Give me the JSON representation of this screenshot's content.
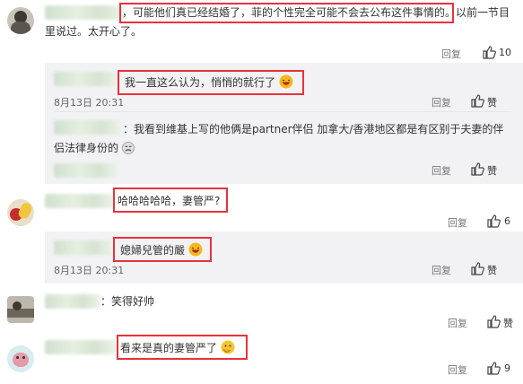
{
  "comments": [
    {
      "text_line1": "，可能他们真已经结婚了，菲的个性完全可能不会去公布这件事情的。以前一节目",
      "text_line2": "里说过。太开心了。",
      "reply_label": "回复",
      "like_count": "10",
      "sub_replies": [
        {
          "text": "我一直这么认为，悄悄的就行了",
          "date": "8月13日 20:31",
          "reply_label": "回复",
          "like_label": "赞"
        },
        {
          "text_line1": "：我看到维基上写的他俩是partner伴侣 加拿大/香港地区都是有区别于夫妻的伴",
          "text_line2": "侣法律身份的",
          "reply_label": "回复",
          "like_label": "赞"
        }
      ]
    },
    {
      "text": "哈哈哈哈哈，妻管严?",
      "reply_label": "回复",
      "like_count": "6",
      "sub_replies": [
        {
          "text": "媳婦兒管的嚴",
          "date": "8月13日 20:31",
          "reply_label": "回复",
          "like_label": "赞"
        }
      ]
    },
    {
      "text": "：笑得好帅",
      "reply_label": "回复",
      "like_label": "赞"
    },
    {
      "text": "看来是真的妻管严了",
      "reply_label": "回复",
      "like_count": "9"
    }
  ],
  "icons": {
    "like": "thumbs-up-icon",
    "laugh": "laughing-face-emoji",
    "sad": "sad-face-emoji",
    "hmm": "thinking-face-emoji"
  },
  "colors": {
    "highlight_border": "#e8323c",
    "panel": "#f2f2f5",
    "text": "#333333",
    "muted": "#777777"
  }
}
